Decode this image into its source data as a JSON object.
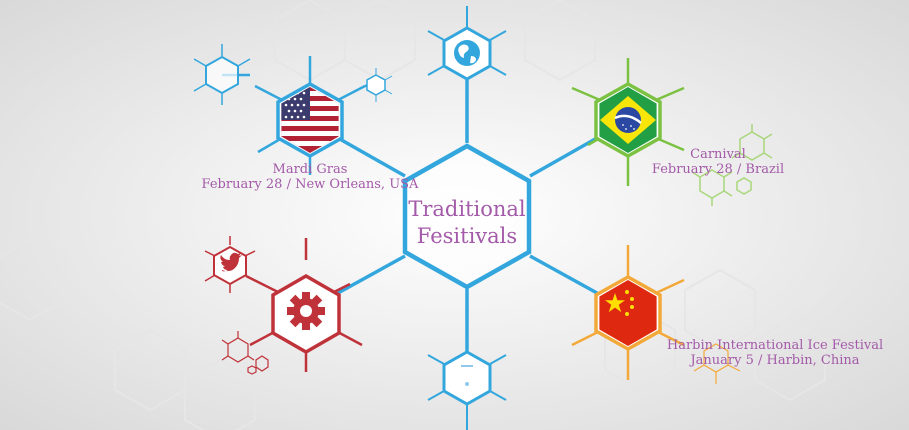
{
  "center": {
    "line1": "Traditional",
    "line2": "Fesitivals"
  },
  "colors": {
    "blue": "#33a7dd",
    "green": "#7cc242",
    "red": "#c0323a",
    "orange": "#f3a93a",
    "text": "#a35aa8"
  },
  "nodes": [
    {
      "id": "usa",
      "icon": "usa-flag-icon",
      "name": "Mardi Gras",
      "detail": "February 28 / New Orleans, USA"
    },
    {
      "id": "brazil",
      "icon": "brazil-flag-icon",
      "name": "Carnival",
      "detail": "February 28 / Brazil"
    },
    {
      "id": "china",
      "icon": "china-flag-icon",
      "name": "Harbin International Ice Festival",
      "detail": "January 5 / Harbin, China"
    },
    {
      "id": "settings",
      "icon": "gear-icon"
    },
    {
      "id": "globe",
      "icon": "globe-icon"
    },
    {
      "id": "twitter",
      "icon": "twitter-icon"
    }
  ]
}
